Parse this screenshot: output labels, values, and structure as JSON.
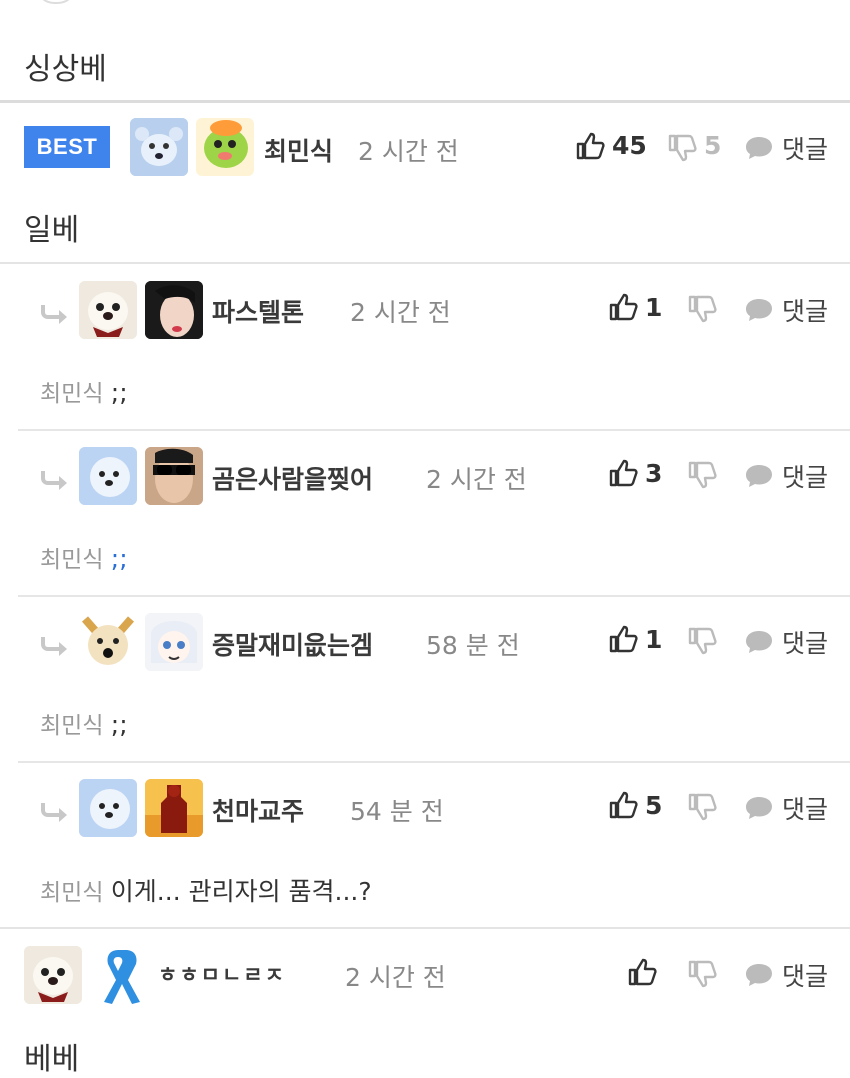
{
  "top_comment": {
    "text": "싱상베"
  },
  "best_comment": {
    "badge": "BEST",
    "nickname": "최민식",
    "time": "2 시간 전",
    "likes": "45",
    "dislikes": "5",
    "reply_label": "댓글",
    "text": "일베"
  },
  "replies": [
    {
      "nickname": "파스텔톤",
      "time": "2 시간 전",
      "likes": "1",
      "reply_label": "댓글",
      "mention": "최민식",
      "text": ";;"
    },
    {
      "nickname": "곰은사람을찢어",
      "time": "2 시간 전",
      "likes": "3",
      "reply_label": "댓글",
      "mention": "최민식",
      "text": ";;"
    },
    {
      "nickname": "증말재미읎는겜",
      "time": "58 분 전",
      "likes": "1",
      "reply_label": "댓글",
      "mention": "최민식",
      "text": ";;"
    },
    {
      "nickname": "천마교주",
      "time": "54 분 전",
      "likes": "5",
      "reply_label": "댓글",
      "mention": "최민식",
      "text": "이게... 관리자의 품격...?"
    }
  ],
  "last_comment": {
    "nickname": "ㅎㅎㅁㄴㄹㅈ",
    "time": "2 시간 전",
    "reply_label": "댓글",
    "text": "베베"
  },
  "colors": {
    "accent": "#3f83ec",
    "mention_blue": "#2a6fd6"
  }
}
